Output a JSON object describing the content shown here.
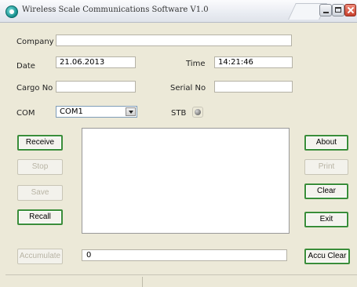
{
  "window": {
    "title": "Wireless Scale Communications Software V1.0"
  },
  "form": {
    "company": {
      "label": "Company",
      "value": ""
    },
    "date": {
      "label": "Date",
      "value": "21.06.2013"
    },
    "time": {
      "label": "Time",
      "value": "14:21:46"
    },
    "cargo_no": {
      "label": "Cargo No",
      "value": ""
    },
    "serial_no": {
      "label": "Serial No",
      "value": ""
    },
    "com": {
      "label": "COM",
      "value": "COM1"
    },
    "stb": {
      "label": "STB",
      "status_color": "#8a8a8a"
    }
  },
  "buttons": {
    "receive": "Receive",
    "stop": "Stop",
    "save": "Save",
    "recall": "Recall",
    "accumulate": "Accumulate",
    "about": "About",
    "print": "Print",
    "clear": "Clear",
    "exit": "Exit",
    "accu_clear": "Accu Clear"
  },
  "accumulate_value": "0",
  "log_text": "",
  "colors": {
    "window_bg": "#ece9d8",
    "active_button_border": "#3a8d3a",
    "disabled_text": "#b8b4a4",
    "close_button": "#c8402c"
  }
}
